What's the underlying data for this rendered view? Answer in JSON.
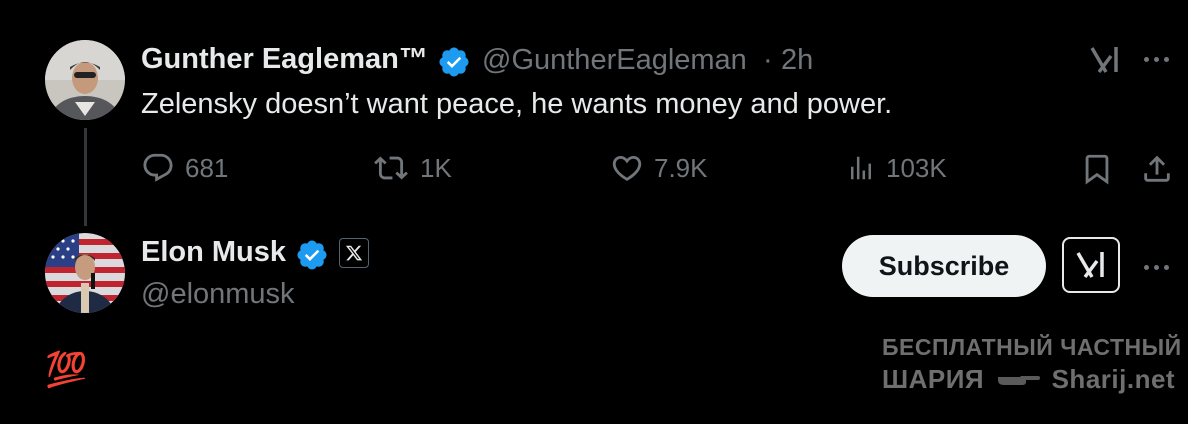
{
  "original_post": {
    "author_name": "Gunther Eagleman™",
    "handle": "@GuntherEagleman",
    "separator": "·",
    "time": "2h",
    "text": "Zelensky doesn’t want peace, he wants money and power.",
    "stats": {
      "replies": "681",
      "reposts": "1K",
      "likes": "7.9K",
      "views": "103K"
    }
  },
  "reply": {
    "author_name": "Elon Musk",
    "handle": "@elonmusk",
    "subscribe_label": "Subscribe",
    "text_emoji": "💯"
  },
  "watermark": {
    "line1": "БЕСПЛАТНЫЙ  ЧАСТНЫЙ",
    "line2_prefix": "ШАРИЯ",
    "line2_suffix": "Sharij.net"
  },
  "icons": {
    "verified": "verified-badge-icon",
    "grok": "grok-icon",
    "more": "more-options-icon",
    "reply": "reply-icon",
    "repost": "repost-icon",
    "like": "heart-icon",
    "views": "views-icon",
    "bookmark": "bookmark-icon",
    "share": "share-icon"
  },
  "colors": {
    "background": "#000000",
    "text": "#e7e9ea",
    "muted": "#71767b",
    "verified_blue": "#1d9bf0"
  }
}
